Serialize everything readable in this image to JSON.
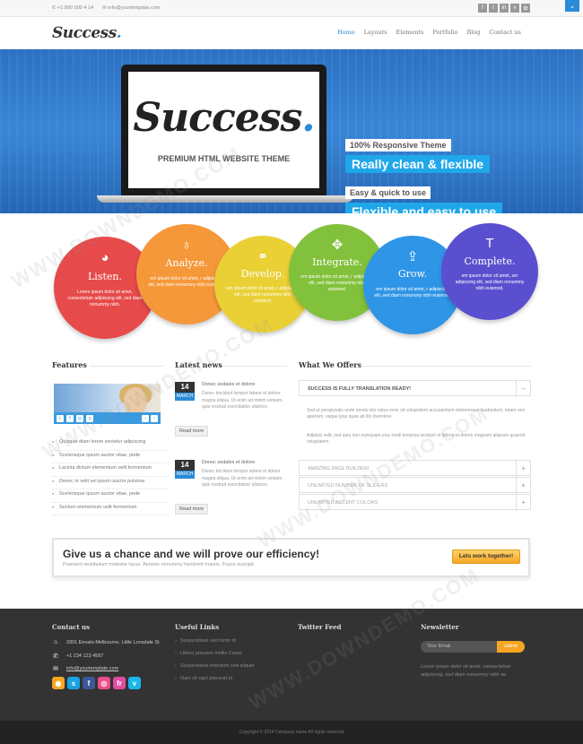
{
  "topbar": {
    "phone": "+1 800 000 4 14",
    "email": "info@yourtemplate.com",
    "social_icons": [
      "facebook-icon",
      "twitter-icon",
      "linkedin-icon",
      "vimeo-icon",
      "flickr-icon"
    ],
    "social_glyphs": [
      "f",
      "t",
      "in",
      "v",
      "✿"
    ],
    "toggle_glyph": "⌄"
  },
  "header": {
    "logo": "Success",
    "nav": [
      "Home",
      "Layouts",
      "Elements",
      "Portfolio",
      "Blog",
      "Contact us"
    ]
  },
  "hero": {
    "laptop_logo": "Success",
    "laptop_sub": "PREMIUM HTML WEBSITE THEME",
    "tag1_small": "100% Responsive Theme",
    "tag1_big": "Really clean & flexible",
    "tag2_small": "Easy & quick to use",
    "tag2_big": "Flexible and easy to use"
  },
  "circles": [
    {
      "title": "Listen.",
      "icon": "globe-icon",
      "glyph": "◕",
      "color": "#e74a4a",
      "text": "Lorem ipsum dolor sit amet, consectetuer adipiscing elit, sed diam nonummy nibh."
    },
    {
      "title": "Analyze.",
      "icon": "lightbulb-icon",
      "glyph": "♁",
      "color": "#f5983a",
      "text": "em ipsum dolor sit amet, r adipiscing elit, sed diam nonummy nibh euismod."
    },
    {
      "title": "Develop.",
      "icon": "link-icon",
      "glyph": "⚭",
      "color": "#ead035",
      "text": "em ipsum dolor sit amet, r adipiscing elit, sed diam nonummy nibh euismod."
    },
    {
      "title": "Integrate.",
      "icon": "puzzle-icon",
      "glyph": "✥",
      "color": "#82c13b",
      "text": "em ipsum dolor sit amet, r adipiscing elit, sed diam nonummy nibh euismod."
    },
    {
      "title": "Grow.",
      "icon": "upload-icon",
      "glyph": "⇪",
      "color": "#2f95e6",
      "text": "em ipsum dolor sit amet, r adipiscing elit, sed diam nonummy nibh euismod."
    },
    {
      "title": "Complete.",
      "icon": "text-icon",
      "glyph": "T",
      "color": "#5a4fcf",
      "text": "em ipsum dolor sit amet, ser adipiscing elit, sed diam nonummy nibh euismod."
    }
  ],
  "features": {
    "title": "Features",
    "slider_icons": [
      "twitter-icon",
      "facebook-icon",
      "dribbble-icon",
      "skype-icon"
    ],
    "slider_glyphs": [
      "t",
      "f",
      "◎",
      "s"
    ],
    "list": [
      "Quisque diam lorem sectetur adipiscing",
      "Scelerisque ipsum auctor vitae, pede",
      "Lacinia dictum elementum velit fermentum",
      "Donec in velit vel ipsum auctor pulvinar",
      "Scelerisque ipsum auctor vitae, pede",
      "Sectum elementum velit fermentum"
    ]
  },
  "news": {
    "title": "Latest news",
    "items": [
      {
        "day": "14",
        "month": "MARCH",
        "title": "Donec sodales et dolore",
        "body": "Donec tincidunt tempor labore et dolore magna aliqua. Ut enim ad minim veniam, quis nostrud exercitation ullamco.",
        "more": "Read more"
      },
      {
        "day": "14",
        "month": "MARCH",
        "title": "Donec sodales et dolore",
        "body": "Donec tincidunt tempor labore et dolore magna aliqua. Ut enim ad minim veniam, quis nostrud exercitation ullamco.",
        "more": "Read more"
      }
    ]
  },
  "offers": {
    "title": "What We Offers",
    "open": {
      "label": "SUCCESS IS FULLY TRANSLATION READY!",
      "toggle": "–"
    },
    "body1": "Sed ut perspiciatis unde omnis iste natus error sit voluptatem accusantium doloremque laudantium, totam rem aperiam, eaque ipsa quae ab illo inventore.",
    "body2": "Adipisci velit, sed quia non numquam eius modi tempora incidunt ut labore et dolore magnam aliquam quaerat voluptatem.",
    "closed": [
      {
        "label": "AMAZING PAGE BUILDER!",
        "toggle": "+"
      },
      {
        "label": "UNLIMITED NUMBER OF SLIDERS",
        "toggle": "+"
      },
      {
        "label": "UNLIMITED ACCENT COLORS",
        "toggle": "+"
      }
    ]
  },
  "cta": {
    "title": "Give us a chance and we will prove our efficiency!",
    "sub": "Praesent vestibulum molestie lacus. Aenean nonummy hendrerit mauris. Fusce suscipit.",
    "button": "Lets work together!"
  },
  "footer": {
    "contact_title": "Contact us",
    "address": "3301 Envato Melbourne, Little Lonsdale St",
    "phone": "+1 234 123 4567",
    "email": "info@yourtemplate.com",
    "social_icons": [
      "rss-icon",
      "skype-icon",
      "facebook-icon",
      "dribbble-icon",
      "flickr-icon",
      "vimeo-icon"
    ],
    "social_glyphs": [
      "◉",
      "s",
      "f",
      "◎",
      "fr",
      "v"
    ],
    "social_colors": [
      "#f5a623",
      "#1aa1e1",
      "#3b5998",
      "#ea4c89",
      "#e04ca0",
      "#1ab7ea"
    ],
    "links_title": "Useful Links",
    "links": [
      "Suspendisse sed tortor id",
      "Libero posuere mollis Curae",
      "Suspendisse interdum sed aliquet",
      "Nam sit eget placerat et"
    ],
    "twitter_title": "Twitter Feed",
    "newsletter_title": "Newsletter",
    "nl_placeholder": "Your Email",
    "nl_button": "submit",
    "nl_text": "Lorem ipsum dolor sit amet, consectetuer adipiscing, sed diam nonummy nibh ne."
  },
  "copyright": "Copyright © 2014 Company name All rights reserved",
  "watermark": "WWW.DOWNDEMO.COM"
}
